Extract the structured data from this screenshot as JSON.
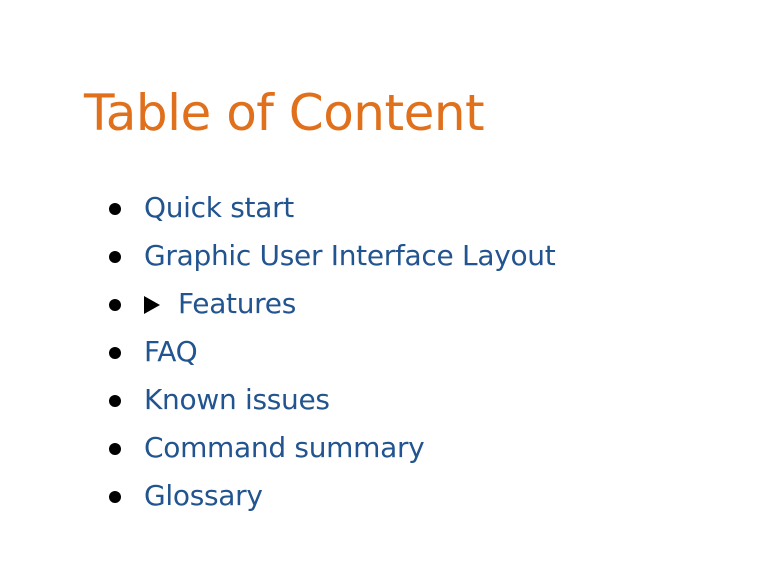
{
  "toc": {
    "title": "Table of Content",
    "items": [
      {
        "label": "Quick start"
      },
      {
        "label": "Graphic User Interface Layout"
      },
      {
        "label": "Features",
        "collapsible": true,
        "expanded": false
      },
      {
        "label": "FAQ"
      },
      {
        "label": "Known issues"
      },
      {
        "label": "Command summary"
      },
      {
        "label": "Glossary"
      }
    ]
  },
  "colors": {
    "title": "#e0701c",
    "link": "#22548f",
    "bullet": "#000000",
    "background": "#ffffff"
  },
  "icons": {
    "bullet": "bullet-dot-icon",
    "disclosure": "disclosure-triangle-right-icon"
  }
}
